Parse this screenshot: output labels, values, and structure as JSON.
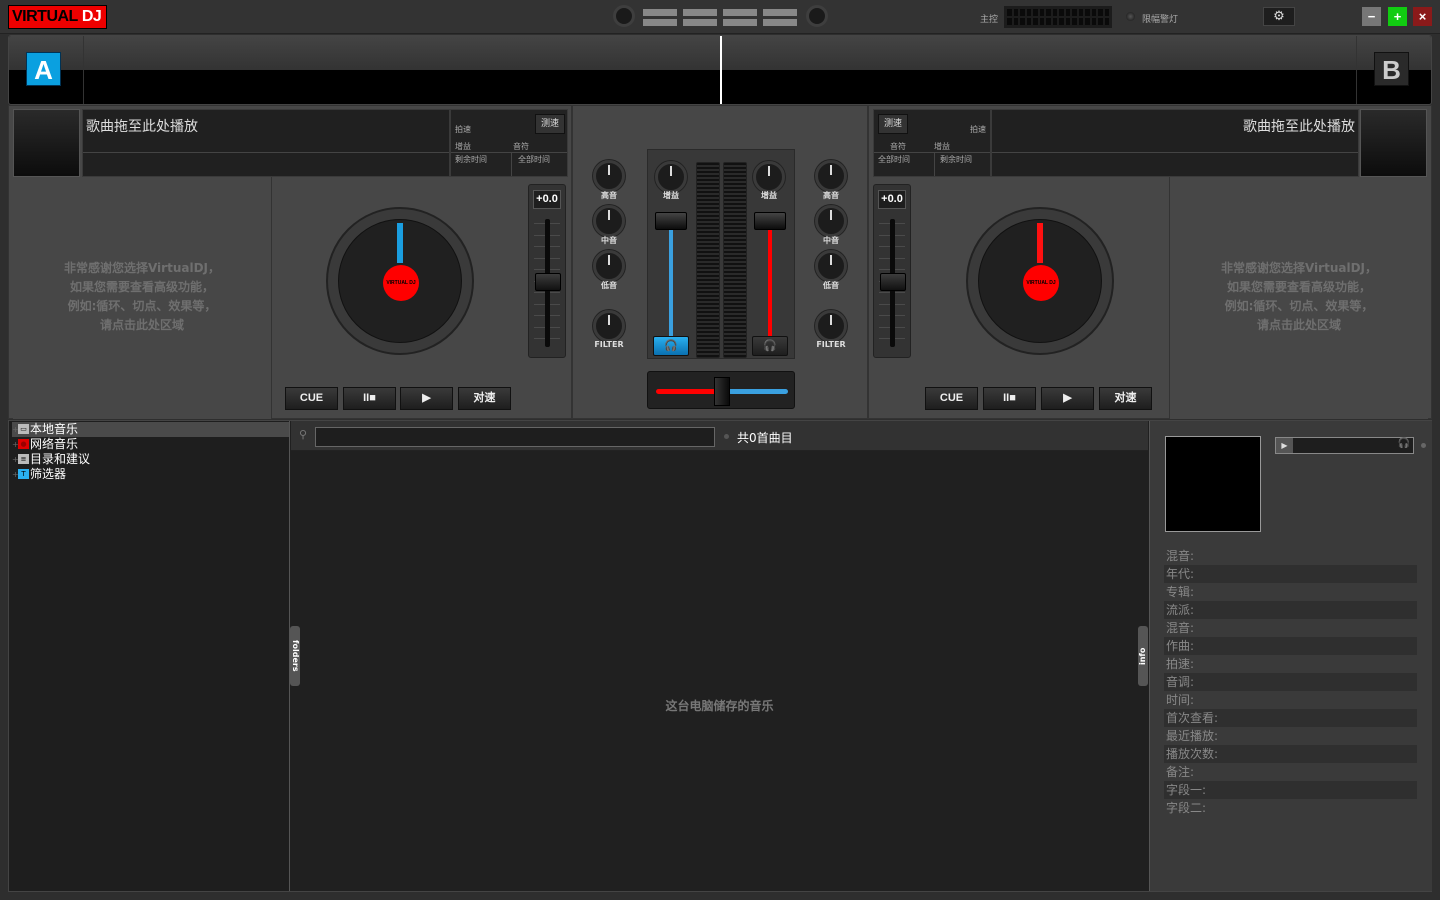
{
  "app": {
    "logo_main": "VIRTUAL",
    "logo_suffix": "DJ",
    "master_label": "主控",
    "limiter_label": "限幅警灯",
    "settings_icon": "⚙",
    "minimize_icon": "−",
    "maximize_icon": "+",
    "close_icon": "×"
  },
  "decks": {
    "a": {
      "badge": "A",
      "title_placeholder": "歌曲拖至此处播放",
      "bpm_label": "拍速",
      "tap_label": "测速",
      "gain_label": "增益",
      "key_label": "音符",
      "remain_label": "剩余时间",
      "total_label": "全部时间",
      "promo_lines": [
        "非常感谢您选择VirtualDJ，",
        "如果您需要查看高级功能，",
        "例如:循环、切点、效果等，",
        "请点击此处区域"
      ],
      "pitch_value": "+0.0",
      "needle_color": "#1a9ee0",
      "platter_label": "VIRTUAL DJ",
      "buttons": {
        "cue": "CUE",
        "pause": "II■",
        "play": "▶",
        "sync": "对速"
      }
    },
    "b": {
      "badge": "B",
      "title_placeholder": "歌曲拖至此处播放",
      "bpm_label": "拍速",
      "tap_label": "测速",
      "gain_label": "增益",
      "key_label": "音符",
      "remain_label": "剩余时间",
      "total_label": "全部时间",
      "promo_lines": [
        "非常感谢您选择VirtualDJ，",
        "如果您需要查看高级功能，",
        "例如:循环、切点、效果等，",
        "请点击此处区域"
      ],
      "pitch_value": "+0.0",
      "needle_color": "#ff1010",
      "platter_label": "VIRTUAL DJ",
      "buttons": {
        "cue": "CUE",
        "pause": "II■",
        "play": "▶",
        "sync": "对速"
      }
    }
  },
  "mixer": {
    "high_label": "高音",
    "mid_label": "中音",
    "low_label": "低音",
    "filter_label": "FILTER",
    "gain_label": "增益",
    "headphone_icon": "🎧",
    "volume_a": 1.0,
    "volume_b": 1.0,
    "crossfader": 0.5,
    "headphone_a_active": true,
    "headphone_b_active": false,
    "colors": {
      "deck_a": "#3aa0e0",
      "deck_b": "#ff0000"
    }
  },
  "browser": {
    "tree": [
      {
        "label": "本地音乐",
        "icon": "computer-icon",
        "selected": true
      },
      {
        "label": "网络音乐",
        "icon": "network-icon",
        "selected": false
      },
      {
        "label": "目录和建议",
        "icon": "list-icon",
        "selected": false
      },
      {
        "label": "筛选器",
        "icon": "filter-icon",
        "selected": false
      }
    ],
    "search": {
      "value": "",
      "placeholder": ""
    },
    "count_label": "共0首曲目",
    "empty_message": "这台电脑储存的音乐",
    "folders_tab": "folders",
    "info_tab": "info"
  },
  "info_panel": {
    "fields": [
      "混音:",
      "年代:",
      "专辑:",
      "流派:",
      "混音:",
      "作曲:",
      "拍速:",
      "音调:",
      "时间:",
      "首次查看:",
      "最近播放:",
      "播放次数:",
      "备注:",
      "字段一:",
      "字段二:"
    ]
  }
}
